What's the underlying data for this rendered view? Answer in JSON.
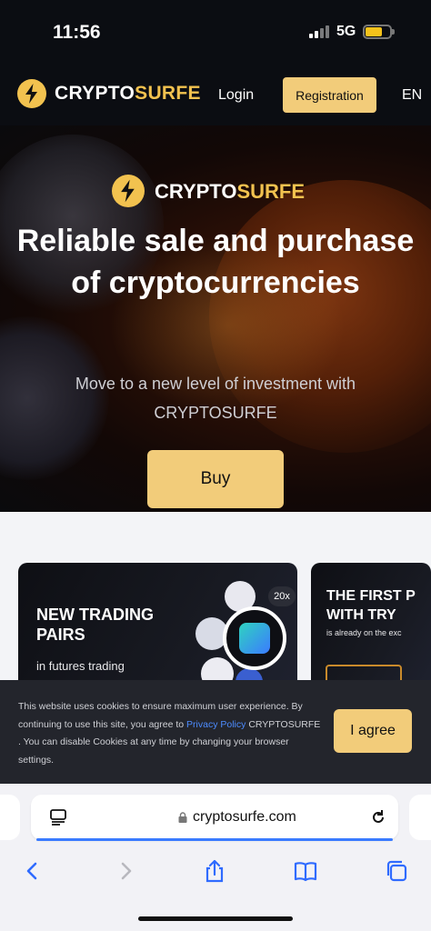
{
  "status_bar": {
    "time": "11:56",
    "network": "5G"
  },
  "nav": {
    "brand_part1": "CRYPTO",
    "brand_part2": "SURFE",
    "login": "Login",
    "registration": "Registration",
    "language": "EN"
  },
  "hero": {
    "brand_part1": "CRYPTO",
    "brand_part2": "SURFE",
    "title": "Reliable sale and purchase of cryptocurrencies",
    "subtitle": "Move to a new level of investment with CRYPTOSURFE",
    "buy": "Buy"
  },
  "promos": [
    {
      "title": "NEW TRADING PAIRS",
      "subtitle": "in futures trading",
      "badge": "20x"
    },
    {
      "title": "THE FIRST P WITH TRY",
      "subtitle": "is already on the exc"
    }
  ],
  "cookie": {
    "text_before": "This website uses cookies to ensure maximum user experience. By continuing to use this site, you agree to",
    "link": "Privacy Policy",
    "text_after": "CRYPTOSURFE . You can disable Cookies at any time by changing your browser settings.",
    "agree": "I agree"
  },
  "browser": {
    "url": "cryptosurfe.com"
  },
  "colors": {
    "accent": "#f2cc7a",
    "dark": "#0b0d12",
    "link": "#4d8cff"
  }
}
